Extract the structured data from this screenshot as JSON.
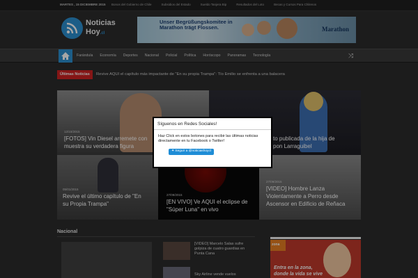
{
  "topbar": {
    "date": "MARTES , 15 DICIEMBRE 2015",
    "links": [
      "Bonos del Gobierno de Chile",
      "Subsidios del Estado",
      "Sueldo Tanjera Bip",
      "Resultados del Loto",
      "Becas y Cursos Para Chilenos"
    ]
  },
  "header": {
    "logo_line1": "Noticias",
    "logo_line2": "Hoy",
    "logo_domain": ".cl",
    "banner_text_1": "Unser Begrüßungskomitee in",
    "banner_text_2": "Marathon trägt Flossen.",
    "banner_brand": "Marathon"
  },
  "nav": {
    "items": [
      "Farándula",
      "Economía",
      "Deportes",
      "Nacional",
      "Policial",
      "Política",
      "Horóscopo",
      "Panoramas",
      "Tecnología"
    ]
  },
  "ticker": {
    "label": "Últimas Noticias",
    "text": "Revive AQUI el capítulo más impactante de \"En su propia Trampa\": Tío Emilio se enfrenta a una balacera"
  },
  "slider": [
    {
      "date": "12/10/2015",
      "title_l1": "[FOTOS] Vin Diesel arremete con",
      "title_l2": "muestra su verdadera figura"
    },
    {
      "date": "",
      "title_l1": "to publicada de la hija de",
      "title_l2": "pon Larraguibel"
    },
    {
      "date": "05/01/2015",
      "title_l1": "Revive el último capítulo de \"En",
      "title_l2": "su Propia Trampa\""
    },
    {
      "date": "27/09/2015",
      "title_l1": "[EN VIVO] Ve AQUI el eclipse de",
      "title_l2": "\"Súper Luna\" en vivo"
    },
    {
      "date": "27/09/2015",
      "title_l1": "[VIDEO] Hombre Lanza",
      "title_l2": "Violentamente a Perro desde",
      "title_l3": "Ascensor en Edificio de Reñaca"
    }
  ],
  "popup": {
    "title": "Síguenos en Redes Sociales!",
    "body": "Haz Click en estos botones para recibir las últimas noticias directamente en tu Facebook o Twitter!",
    "follow_button": "Seguir a @noticiashoycl"
  },
  "section": {
    "title": "Nacional",
    "items": [
      {
        "text": "[VIDEO] Marcelo Salas sufre golpiza de cuatro guardias en Punta Cana"
      },
      {
        "text": "Sky Airline vende vuelos"
      }
    ]
  },
  "ad_right": {
    "logo": "zona",
    "text_1": "Entra en la zona,",
    "text_2": "donde la vida se vive"
  },
  "colors": {
    "accent": "#2b8fd0",
    "ticker_label": "#cc2222"
  }
}
